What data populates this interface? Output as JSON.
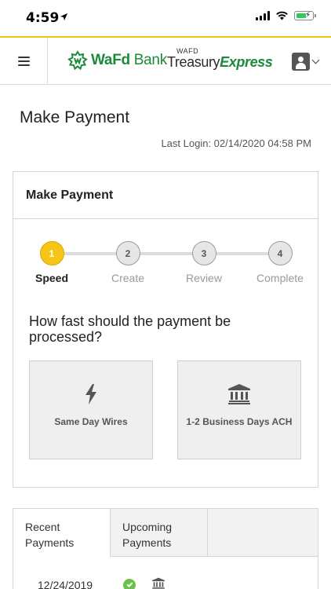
{
  "status_bar": {
    "time": "4:59",
    "location_icon": "location-arrow-icon",
    "signal_icon": "cellular-signal-icon",
    "wifi_icon": "wifi-icon",
    "battery_icon": "battery-charging-icon"
  },
  "header": {
    "menu_icon": "hamburger-menu-icon",
    "bank_logo": {
      "prefix": "WaFd",
      "suffix": " Bank"
    },
    "product_logo": {
      "small": "WAFD",
      "main": "Treasury",
      "accent": "Express"
    },
    "user_icon": "user-account-icon",
    "accent_color": "#f2c40f",
    "brand_color": "#1b8a3a"
  },
  "page": {
    "title": "Make Payment",
    "last_login": "Last Login: 02/14/2020 04:58 PM"
  },
  "wizard": {
    "panel_title": "Make Payment",
    "active_step": 1,
    "steps": [
      {
        "number": "1",
        "label": "Speed"
      },
      {
        "number": "2",
        "label": "Create"
      },
      {
        "number": "3",
        "label": "Review"
      },
      {
        "number": "4",
        "label": "Complete"
      }
    ],
    "question": "How fast should the payment be processed?",
    "options": [
      {
        "icon": "lightning-bolt-icon",
        "label": "Same Day Wires"
      },
      {
        "icon": "bank-building-icon",
        "label": "1-2 Business Days ACH"
      }
    ]
  },
  "payments_tabs": {
    "tabs": [
      {
        "label": "Recent Payments",
        "line1": "Recent",
        "line2": "Payments",
        "selected": true
      },
      {
        "label": "Upcoming Payments",
        "line1": "Upcoming",
        "line2": "Payments",
        "selected": false
      }
    ],
    "rows": [
      {
        "date": "12/24/2019",
        "status_icon": "check-circle-icon",
        "type_icon": "bank-building-icon"
      }
    ]
  }
}
